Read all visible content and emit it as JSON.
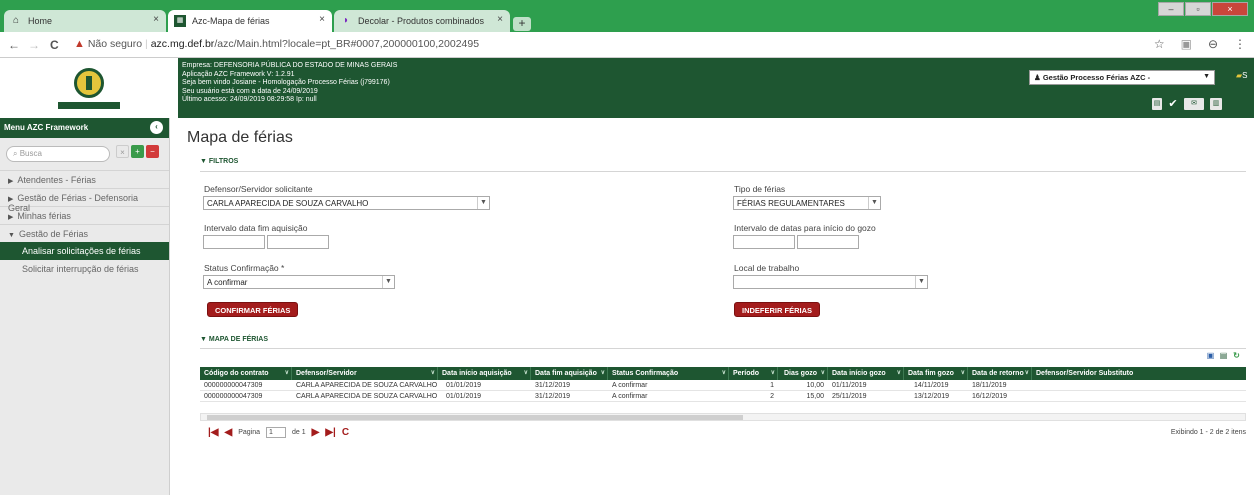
{
  "browser": {
    "tabs": [
      {
        "label": "Home",
        "active": false
      },
      {
        "label": "Azc-Mapa de férias",
        "active": true
      },
      {
        "label": "Decolar - Produtos combinados",
        "active": false
      }
    ],
    "new_tab": "+",
    "back": "←",
    "forward": "→",
    "reload": "C",
    "security_label": "Não seguro",
    "url_domain": "azc.mg.def.br",
    "url_path": "/azc/Main.html?locale=pt_BR#0007,200000100,2002495",
    "close_glyph": "×"
  },
  "header": {
    "company": "Empresa: DEFENSORIA PÚBLICA DO ESTADO DE MINAS GERAIS",
    "application": "Aplicação AZC Framework V: 1.2.91",
    "welcome": "Seja bem vindo Josiane - Homologação Processo Férias (j799176)",
    "user_date": "Seu usuário está com a data de 24/09/2019",
    "last_access": "Último acesso: 24/09/2019 08:29:58 Ip: null",
    "process_select": "Gestão Processo Férias AZC -",
    "right_text": "S"
  },
  "sidebar": {
    "title": "Menu AZC Framework",
    "search_placeholder": "Busca",
    "items": [
      {
        "label": "Atendentes - Férias"
      },
      {
        "label": "Gestão de Férias - Defensoria Geral"
      },
      {
        "label": "Minhas férias"
      },
      {
        "label": "Gestão de Férias"
      }
    ],
    "sub_items": [
      {
        "label": "Analisar solicitações de férias",
        "active": true
      },
      {
        "label": "Solicitar interrupção de férias",
        "active": false
      }
    ]
  },
  "page": {
    "title": "Mapa de férias"
  },
  "filters": {
    "section_label": "FILTROS",
    "requester_label": "Defensor/Servidor solicitante",
    "requester_value": "CARLA APARECIDA DE SOUZA CARVALHO",
    "vacation_type_label": "Tipo de férias",
    "vacation_type_value": "FÉRIAS REGULAMENTARES",
    "acq_interval_label": "Intervalo data fim aquisição",
    "start_interval_label": "Intervalo de datas para início do gozo",
    "status_label": "Status Confirmação *",
    "status_value": "A confirmar",
    "workplace_label": "Local de trabalho",
    "workplace_value": "",
    "confirm_button": "CONFIRMAR FÉRIAS",
    "reject_button": "INDEFERIR FÉRIAS"
  },
  "grid": {
    "section_label": "MAPA DE FÉRIAS",
    "columns": [
      "Código do contrato",
      "Defensor/Servidor",
      "Data início aquisição",
      "Data fim aquisição",
      "Status Confirmação",
      "Período",
      "Dias gozo",
      "Data início gozo",
      "Data fim gozo",
      "Data de retorno",
      "Defensor/Servidor Substituto"
    ],
    "rows": [
      [
        "000000000047309",
        "CARLA APARECIDA DE SOUZA CARVALHO",
        "01/01/2019",
        "31/12/2019",
        "A confirmar",
        "1",
        "10,00",
        "01/11/2019",
        "14/11/2019",
        "18/11/2019",
        ""
      ],
      [
        "000000000047309",
        "CARLA APARECIDA DE SOUZA CARVALHO",
        "01/01/2019",
        "31/12/2019",
        "A confirmar",
        "2",
        "15,00",
        "25/11/2019",
        "13/12/2019",
        "16/12/2019",
        ""
      ]
    ],
    "pager_page_label": "Pagina",
    "pager_page_value": "1",
    "pager_of": "de 1",
    "pager_info": "Exibindo 1 - 2 de 2 itens"
  }
}
